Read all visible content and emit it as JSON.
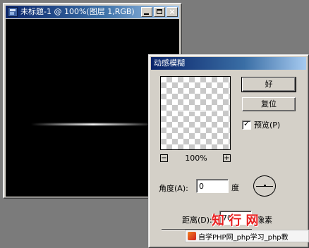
{
  "document_window": {
    "title": "未标题-1 @ 100%(图层 1,RGB)",
    "buttons": {
      "minimize_icon": "minimize-icon",
      "maximize_icon": "maximize-icon",
      "close_glyph": "×"
    }
  },
  "dialog": {
    "title": "动感模糊",
    "ok_label": "好",
    "reset_label": "复位",
    "preview_label": "预览(P)",
    "preview_checked": true,
    "zoom_out": "−",
    "zoom_in": "+",
    "zoom_level": "100%",
    "angle_label": "角度(A):",
    "angle_value": "0",
    "angle_unit": "度",
    "distance_label": "距离(D):",
    "distance_value": "70",
    "distance_unit": "像素"
  },
  "watermark": {
    "brand": "知 行 网",
    "text": "自学PHP网_php学习_php教"
  },
  "colors": {
    "titlebar_start": "#0a246a",
    "titlebar_end": "#a6caf0",
    "dialog_face": "#d4d0c8",
    "desktop": "#7b7b7b",
    "watermark_red": "#e82020"
  }
}
